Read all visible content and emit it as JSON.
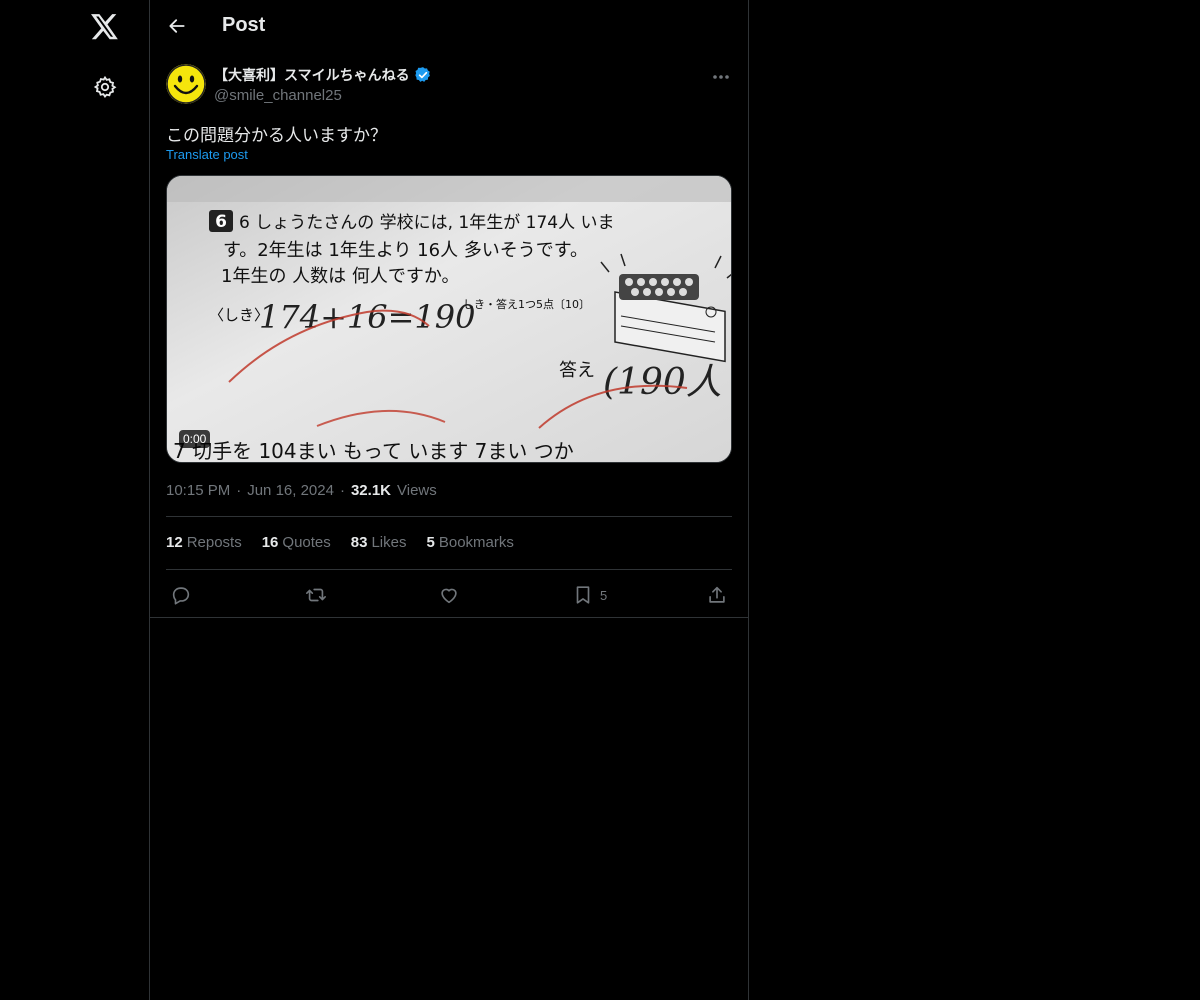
{
  "header": {
    "title": "Post"
  },
  "icons": {
    "logo": "x-logo-icon",
    "settings": "gear-icon",
    "back": "arrow-left-icon",
    "verified": "verified-badge-icon",
    "more": "more-dots-icon",
    "reply": "reply-icon",
    "repost": "repost-icon",
    "like": "heart-icon",
    "bookmark": "bookmark-icon",
    "share": "share-icon"
  },
  "colors": {
    "accent": "#1d9bf0",
    "verified": "#1d9bf0",
    "background": "#000000",
    "muted": "#71767b"
  },
  "post": {
    "author_name": "【大喜利】スマイルちゃんねる",
    "author_handle": "@smile_channel25",
    "text": "この問題分かる人いますか？",
    "translate_label": "Translate post",
    "video_duration": "0:00",
    "time": "10:15 PM",
    "date": "Jun 16, 2024",
    "views_count": "32.1K",
    "views_label": "Views",
    "separator": "·"
  },
  "media_text": {
    "line1": "6 しょうたさんの 学校には, 1年生が 174人 いま",
    "line2": "す。2年生は 1年生より 16人 多いそうです。",
    "line3": "1年生の 人数は 何人ですか。",
    "shiki_label": "〈しき〉",
    "shiki_answer": "174+16=190",
    "points": "しき・答え1つ5点〔10〕",
    "answer_label": "答え",
    "answer_value": "(190人",
    "line4": "7 切手を 104まい もって います 7まい つか"
  },
  "stats": {
    "reposts_count": "12",
    "reposts_label": "Reposts",
    "quotes_count": "16",
    "quotes_label": "Quotes",
    "likes_count": "83",
    "likes_label": "Likes",
    "bookmarks_count": "5",
    "bookmarks_label": "Bookmarks"
  },
  "actions": {
    "bookmark_count": "5"
  }
}
